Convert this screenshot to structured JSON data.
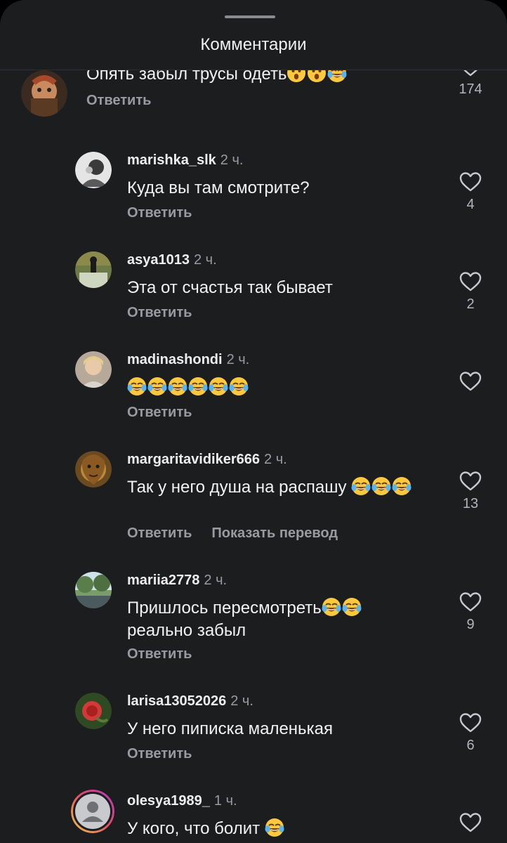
{
  "header": {
    "title": "Комментарии"
  },
  "comments": [
    {
      "user": "",
      "time": "",
      "text": "Опять забыл трусы одеть",
      "emoji": [
        "hushed-face-emoji",
        "hushed-face-emoji",
        "tears-of-joy-emoji"
      ],
      "reply": "Ответить",
      "translate": "",
      "likes": "174",
      "avatar_color": "#8a5a3a"
    },
    {
      "user": "marishka_slk",
      "time": "2 ч.",
      "text": "Куда вы там смотрите?",
      "emoji": [],
      "reply": "Ответить",
      "translate": "",
      "likes": "4",
      "avatar_color": "#d8d8d8"
    },
    {
      "user": "asya1013",
      "time": "2 ч.",
      "text": "Эта от счастья так бывает",
      "emoji": [],
      "reply": "Ответить",
      "translate": "",
      "likes": "2",
      "avatar_color": "#5b6a44"
    },
    {
      "user": "madinashondi",
      "time": "2 ч.",
      "text": "",
      "emoji": [
        "tears-of-joy-emoji",
        "tears-of-joy-emoji",
        "tears-of-joy-emoji",
        "tears-of-joy-emoji",
        "tears-of-joy-emoji",
        "tears-of-joy-emoji"
      ],
      "reply": "Ответить",
      "translate": "",
      "likes": "",
      "avatar_color": "#c9b9a8"
    },
    {
      "user": "margaritavidiker666",
      "time": "2 ч.",
      "text": "Так у него душа на распашу",
      "emoji": [
        "tears-of-joy-emoji",
        "tears-of-joy-emoji",
        "tears-of-joy-emoji"
      ],
      "reply": "Ответить",
      "translate": "Показать перевод",
      "likes": "13",
      "avatar_color": "#7a5a2a"
    },
    {
      "user": "mariia2778",
      "time": "2 ч.",
      "text": "Пришлось пересмотреть",
      "text2": "реально забыл",
      "emoji": [
        "tears-of-joy-emoji",
        "tears-of-joy-emoji"
      ],
      "reply": "Ответить",
      "translate": "",
      "likes": "9",
      "avatar_color": "#5d7f5a"
    },
    {
      "user": "larisa13052026",
      "time": "2 ч.",
      "text": "У него пиписка маленькая",
      "emoji": [],
      "reply": "Ответить",
      "translate": "",
      "likes": "6",
      "avatar_color": "#3e5a2e"
    },
    {
      "user": "olesya1989_",
      "time": "1 ч.",
      "text": "У кого, что болит",
      "emoji": [
        "tears-of-joy-emoji"
      ],
      "reply": "",
      "translate": "",
      "likes": "",
      "avatar_color": "#c9cacd"
    }
  ],
  "colors": {
    "background": "#1c1d1f",
    "text": "#f2f2f2",
    "muted": "#9a9b9e",
    "story_ring": "#e3b24a"
  },
  "icons": {
    "like": "heart-outline-icon"
  }
}
